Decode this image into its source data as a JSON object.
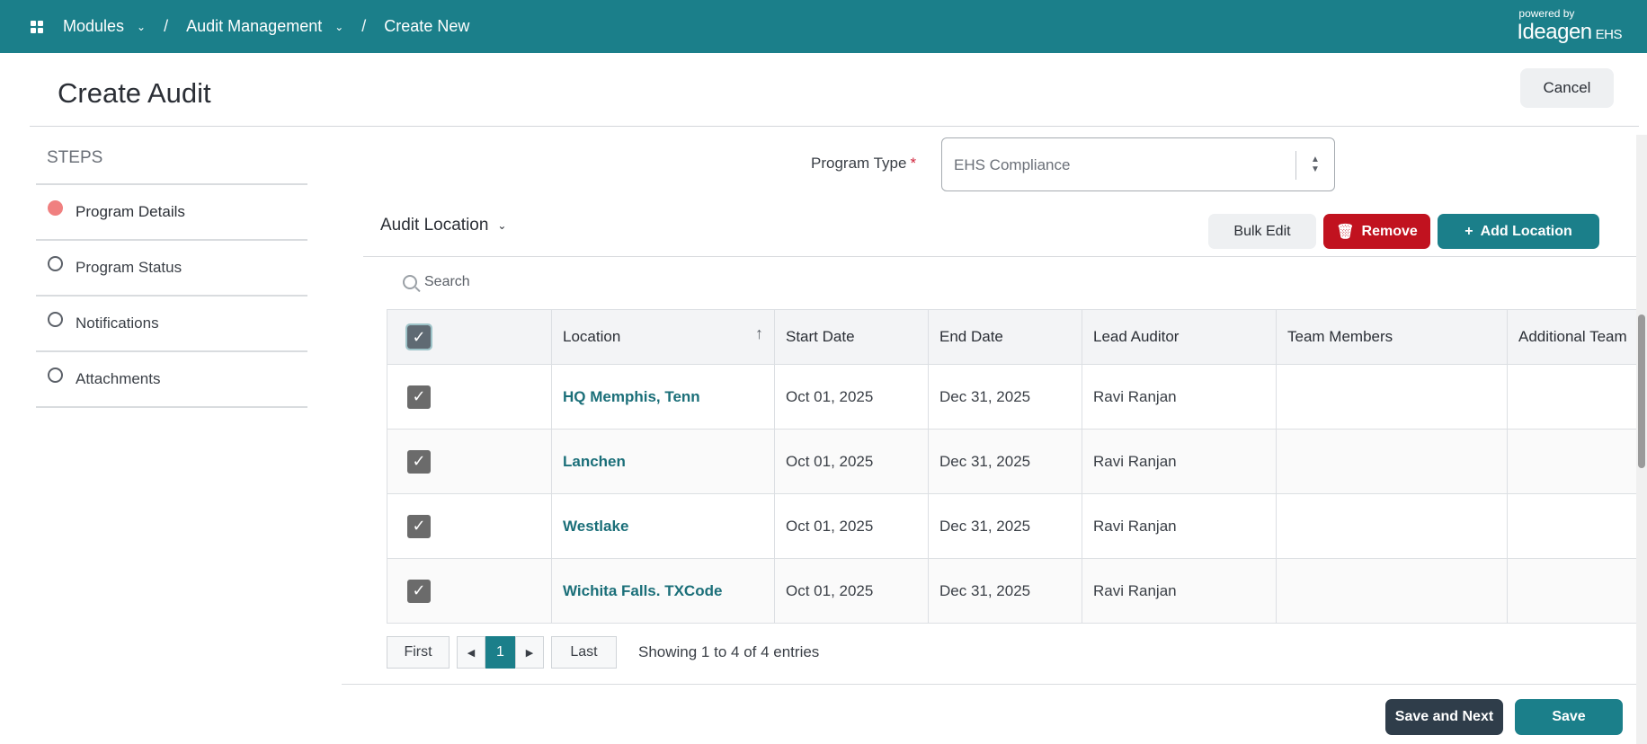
{
  "breadcrumbs": {
    "modules": "Modules",
    "audit_management": "Audit Management",
    "current": "Create New",
    "separator": "/"
  },
  "brand": {
    "powered_by": "powered by",
    "logo": "Ideagen",
    "suffix": "EHS"
  },
  "page": {
    "title": "Create Audit",
    "cancel_label": "Cancel"
  },
  "steps": {
    "title": "STEPS",
    "items": [
      {
        "label": "Program Details",
        "active": true
      },
      {
        "label": "Program Status",
        "active": false
      },
      {
        "label": "Notifications",
        "active": false
      },
      {
        "label": "Attachments",
        "active": false
      }
    ]
  },
  "program_type": {
    "label": "Program Type",
    "required_mark": "*",
    "value": "EHS Compliance"
  },
  "audit_location": {
    "title": "Audit Location",
    "bulk_edit_label": "Bulk Edit",
    "remove_label": "Remove",
    "add_location_label": "Add Location",
    "search_placeholder": "Search"
  },
  "table": {
    "columns": [
      "Location",
      "Start Date",
      "End Date",
      "Lead Auditor",
      "Team Members",
      "Additional Team"
    ],
    "rows": [
      {
        "location": "HQ Memphis, Tenn",
        "start": "Oct 01, 2025",
        "end": "Dec 31, 2025",
        "lead": "Ravi Ranjan",
        "team": "",
        "additional": ""
      },
      {
        "location": "Lanchen",
        "start": "Oct 01, 2025",
        "end": "Dec 31, 2025",
        "lead": "Ravi Ranjan",
        "team": "",
        "additional": ""
      },
      {
        "location": "Westlake",
        "start": "Oct 01, 2025",
        "end": "Dec 31, 2025",
        "lead": "Ravi Ranjan",
        "team": "",
        "additional": ""
      },
      {
        "location": "Wichita Falls. TXCode",
        "start": "Oct 01, 2025",
        "end": "Dec 31, 2025",
        "lead": "Ravi Ranjan",
        "team": "",
        "additional": ""
      }
    ]
  },
  "pagination": {
    "first_label": "First",
    "last_label": "Last",
    "current_page": "1",
    "showing_text": "Showing 1 to 4 of 4 entries"
  },
  "footer": {
    "save_next_label": "Save and Next",
    "save_label": "Save"
  },
  "colors": {
    "primary": "#1b7f8a",
    "danger": "#c1121f",
    "dark": "#2f3d4a",
    "active_step": "#f08080"
  }
}
